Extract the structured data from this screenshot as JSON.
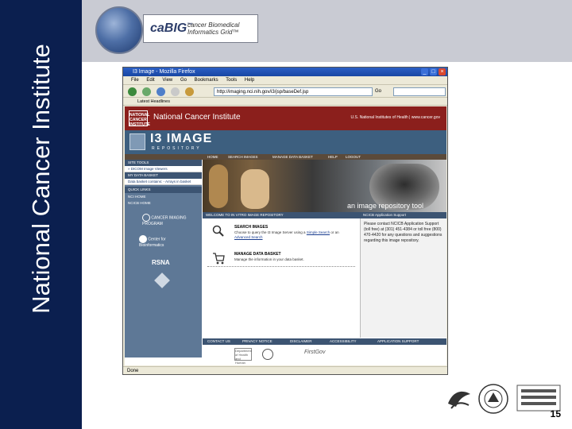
{
  "slide": {
    "vertical_title": "National Cancer Institute",
    "page_number": "15",
    "logos": [
      "Department of Health & Human Services seal",
      "National Institutes of Health seal",
      "National Cancer Institute logo"
    ]
  },
  "cabig": {
    "logo_text": "caBIG",
    "tm": "™",
    "subtitle": "cancer Biomedical Informatics Grid™"
  },
  "browser": {
    "window_title": "I3 Image - Mozilla Firefox",
    "menu": [
      "File",
      "Edit",
      "View",
      "Go",
      "Bookmarks",
      "Tools",
      "Help"
    ],
    "url": "http://imaging.nci.nih.gov/i3/jsp/baseDef.jsp",
    "go_label": "Go",
    "bookmark": "Latest Headlines",
    "status": "Done"
  },
  "site": {
    "nci_logo": "NATIONAL CANCER INSTITUTE",
    "nci_name": "National Cancer Institute",
    "nih_link": "U.S. National Institutes of Health | www.cancer.gov",
    "i3_title": "I3 IMAGE",
    "i3_subtitle": "REPOSITORY",
    "nav": [
      "HOME",
      "SEARCH IMAGES",
      "MANAGE DATA BASKET",
      "HELP",
      "LOGOUT"
    ],
    "sidebar": {
      "site_tools": "SITE TOOLS",
      "dicom_link": "» DICOM Image Viewers",
      "my_basket": "MY DATA BASKET",
      "basket_contains": "Data basket contains: - Arrays in basket",
      "quick_links": "QUICK LINKS",
      "links": [
        "NCI HOME",
        "NCICB HOME"
      ],
      "logos": [
        "CANCER IMAGING PROGRAM",
        "Center for Bioinformatics",
        "RSNA",
        ""
      ]
    },
    "hero_tag": "an image repository tool",
    "welcome_title": "WELCOME TO IN VITRO IMAGE REPOSITORY",
    "search": {
      "heading": "SEARCH IMAGES",
      "text": "Choose to query the I3 Image Server using a",
      "simple": "Simple Search",
      "or": "or an",
      "advanced": "Advanced Search"
    },
    "basket": {
      "heading": "MANAGE DATA BASKET",
      "text": "Manage the information in your data basket."
    },
    "support_title": "NCICB Application Support",
    "support_text": "Please contact NCICB Application Support (toll free) at (301) 451-4384 or toll free (800) 470-4420 for any questions and suggestions regarding this image repository.",
    "footer": [
      "CONTACT US",
      "PRIVACY NOTICE",
      "DISCLAIMER",
      "ACCESSIBILITY",
      "APPLICATION SUPPORT"
    ],
    "footer_logos": [
      "Department of Health and Human Services",
      "USA.gov seal",
      "FirstGov"
    ]
  }
}
